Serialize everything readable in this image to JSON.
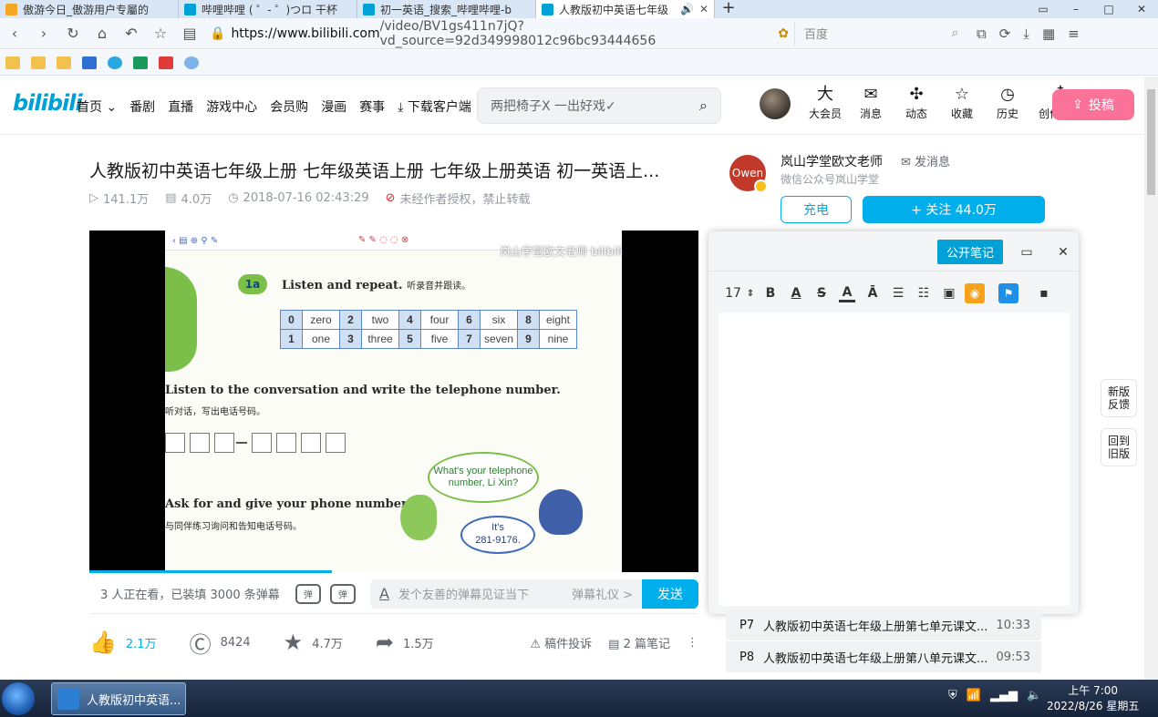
{
  "browser": {
    "tabs": [
      {
        "label": "傲游今日_傲游用户专屬的",
        "color": "#f5a623"
      },
      {
        "label": "哔哩哔哩 ( ゜- ゜)つロ 干杯",
        "color": "#00a1d6"
      },
      {
        "label": "初一英语_搜索_哔哩哔哩-b",
        "color": "#00a1d6"
      },
      {
        "label": "人教版初中英语七年级",
        "color": "#00a1d6",
        "active": true
      }
    ],
    "new_tab": "+",
    "url_host": "https://www.bilibili.com",
    "url_rest": "/video/BV1gs411n7jQ?vd_source=92d349998012c96bc93444656",
    "search_placeholder": "百度"
  },
  "header": {
    "logo": "bilibili",
    "nav": [
      "首页",
      "番剧",
      "直播",
      "游戏中心",
      "会员购",
      "漫画",
      "赛事",
      "下载客户端"
    ],
    "search_placeholder": "两把椅子X 一出好戏✓",
    "icons": [
      {
        "label": "大会员",
        "icon": "大"
      },
      {
        "label": "消息",
        "icon": "✉"
      },
      {
        "label": "动态",
        "icon": "✣"
      },
      {
        "label": "收藏",
        "icon": "☆"
      },
      {
        "label": "历史",
        "icon": "◷"
      },
      {
        "label": "创作中心",
        "icon": "♁"
      }
    ],
    "upload_label": "投稿"
  },
  "video": {
    "title": "人教版初中英语七年级上册 七年级英语上册 七年级上册英语 初一英语上...",
    "views": "141.1万",
    "danmaku": "4.0万",
    "date": "2018-07-16 02:43:29",
    "copyright": "未经作者授权，禁止转载"
  },
  "uploader": {
    "avatar_text": "Owen",
    "name": "岚山学堂欧文老师",
    "message_label": "发消息",
    "description": "微信公众号岚山学堂",
    "charge_label": "充电",
    "follow_label": "+ 关注 44.0万"
  },
  "player": {
    "watermark": "岚山学堂欧文老师 bilibili",
    "badge": "1a",
    "heading1_en": "Listen and repeat.",
    "heading1_cn": "听录音并跟读。",
    "numbers": [
      [
        "0",
        "zero",
        "2",
        "two",
        "4",
        "four",
        "6",
        "six",
        "8",
        "eight"
      ],
      [
        "1",
        "one",
        "3",
        "three",
        "5",
        "five",
        "7",
        "seven",
        "9",
        "nine"
      ]
    ],
    "heading2_en": "Listen to the conversation and write the telephone number.",
    "heading2_cn": "听对话，写出电话号码。",
    "heading3_en": "Ask for and give your phone numbers.",
    "heading3_cn": "与同伴练习询问和告知电话号码。",
    "bubble1": "What's your telephone number, Li Xin?",
    "bubble2_line1": "It's",
    "bubble2_line2": "281-9176."
  },
  "danmaku_bar": {
    "info": "3 人正在看，已装填 3000 条弹幕",
    "input_placeholder": "发个友善的弹幕见证当下",
    "etiquette": "弹幕礼仪 >",
    "send_label": "发送"
  },
  "actions": {
    "like": "2.1万",
    "coin": "8424",
    "favorite": "4.7万",
    "share": "1.5万",
    "report": "稿件投诉",
    "notes": "2 篇笔记"
  },
  "notes_panel": {
    "publish_label": "公开笔记",
    "font_size": "17"
  },
  "side_tabs": [
    "新版反馈",
    "回到旧版"
  ],
  "playlist": [
    {
      "p": "P7",
      "title": "人教版初中英语七年级上册第七单元课文...",
      "duration": "10:33"
    },
    {
      "p": "P8",
      "title": "人教版初中英语七年级上册第八单元课文...",
      "duration": "09:53"
    }
  ],
  "taskbar": {
    "task_label": "人教版初中英语...",
    "time": "上午 7:00",
    "date": "2022/8/26 星期五"
  }
}
